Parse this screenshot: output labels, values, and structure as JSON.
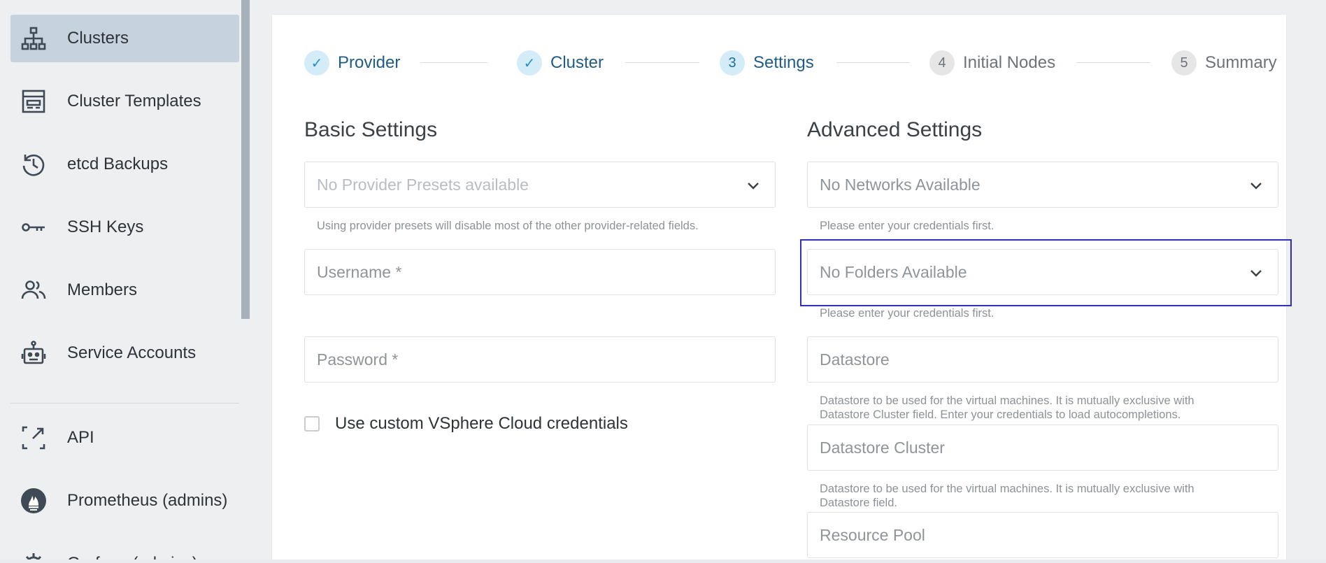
{
  "sidebar": {
    "items": [
      {
        "label": "Clusters",
        "icon": "sitemap-icon",
        "active": true
      },
      {
        "label": "Cluster Templates",
        "icon": "template-icon"
      },
      {
        "label": "etcd Backups",
        "icon": "history-icon"
      },
      {
        "label": "SSH Keys",
        "icon": "key-icon"
      },
      {
        "label": "Members",
        "icon": "people-icon"
      },
      {
        "label": "Service Accounts",
        "icon": "robot-icon"
      },
      {
        "label": "API",
        "icon": "external-link-icon"
      },
      {
        "label": "Prometheus (admins)",
        "icon": "prometheus-icon"
      },
      {
        "label": "Grafana (admins)",
        "icon": "grafana-icon"
      }
    ]
  },
  "stepper": {
    "steps": [
      {
        "marker": "✓",
        "label": "Provider",
        "state": "done"
      },
      {
        "marker": "✓",
        "label": "Cluster",
        "state": "done"
      },
      {
        "marker": "3",
        "label": "Settings",
        "state": "current"
      },
      {
        "marker": "4",
        "label": "Initial Nodes",
        "state": "todo"
      },
      {
        "marker": "5",
        "label": "Summary",
        "state": "todo"
      }
    ]
  },
  "basic": {
    "title": "Basic Settings",
    "preset_placeholder": "No Provider Presets available",
    "preset_hint": "Using provider presets will disable most of the other provider-related fields.",
    "username_placeholder": "Username *",
    "password_placeholder": "Password *",
    "custom_credentials_label": "Use custom VSphere Cloud credentials"
  },
  "advanced": {
    "title": "Advanced Settings",
    "networks_placeholder": "No Networks Available",
    "networks_hint": "Please enter your credentials first.",
    "folders_placeholder": "No Folders Available",
    "folders_hint": "Please enter your credentials first.",
    "datastore_placeholder": "Datastore",
    "datastore_hint_1": "Datastore to be used for the virtual machines. It is mutually exclusive with",
    "datastore_hint_2": "Datastore Cluster field.  Enter your credentials to load autocompletions.",
    "datastore_cluster_placeholder": "Datastore Cluster",
    "datastore_cluster_hint_1": "Datastore to be used for the virtual machines. It is mutually exclusive with",
    "datastore_cluster_hint_2": "Datastore field.",
    "resource_pool_placeholder": "Resource Pool"
  },
  "colors": {
    "accent": "#2690c7",
    "active_nav": "#c6d3de",
    "highlight": "#2f2fbf"
  }
}
